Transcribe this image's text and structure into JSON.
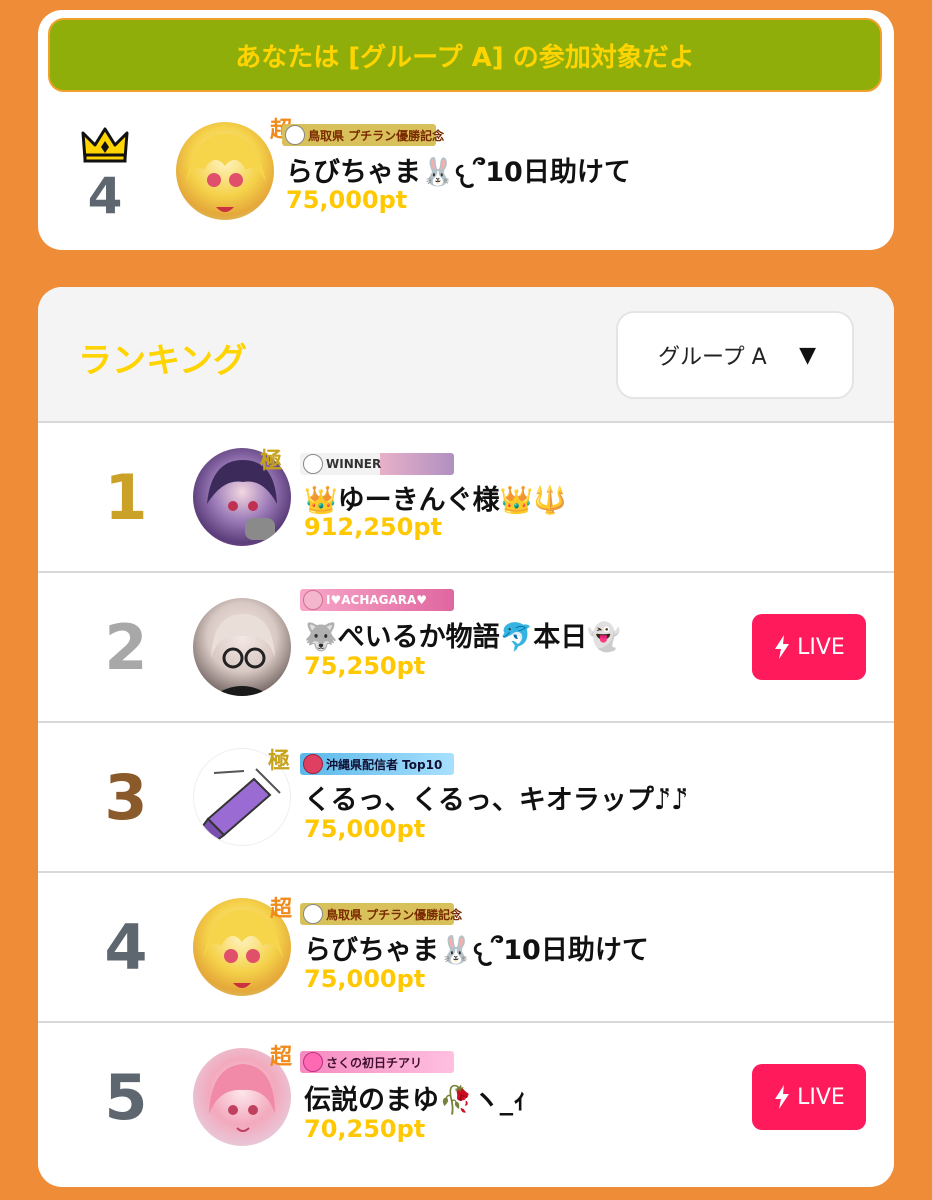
{
  "banner": "あなたは [グループ A] の参加対象だよ",
  "my_entry": {
    "rank": "4",
    "rank_icon": "crown-icon",
    "tier": "超",
    "badge": "鳥取県 プチラン優勝記念",
    "name": "らびちゃま🐰𐔌՞10日助けて",
    "points": "75,000pt"
  },
  "ranking": {
    "title": "ランキング",
    "group_select": {
      "value": "グループ A",
      "icon": "triangle-down-icon"
    },
    "rows": [
      {
        "rank": "1",
        "rank_color": "#c9a227",
        "tier": "極",
        "badge": "WINNER",
        "name": "👑ゆーきんぐ様👑🔱",
        "points": "912,250pt",
        "live": ""
      },
      {
        "rank": "2",
        "rank_color": "#a8a8a8",
        "tier": "",
        "badge": "I♥ACHAGARA♥",
        "name": "🐺ぺいるか物語🐬本日👻",
        "points": "75,250pt",
        "live": "LIVE"
      },
      {
        "rank": "3",
        "rank_color": "#8b5a2b",
        "tier": "極",
        "badge": "沖縄県配信者 Top10",
        "name": "くるっ、くるっ、キオラップ♪̈♪̈",
        "points": "75,000pt",
        "live": ""
      },
      {
        "rank": "4",
        "rank_color": "#5e6770",
        "tier": "超",
        "badge": "鳥取県 プチラン優勝記念",
        "name": "らびちゃま🐰𐔌՞10日助けて",
        "points": "75,000pt",
        "live": ""
      },
      {
        "rank": "5",
        "rank_color": "#5e6770",
        "tier": "超",
        "badge": "さくの初日チアリ",
        "name": "伝説のまゆ🥀ヽ_ｨ",
        "points": "70,250pt",
        "live": "LIVE"
      }
    ]
  },
  "colors": {
    "background": "#ee8c38",
    "banner": "#8fae0a",
    "accent_yellow": "#ffd400",
    "points": "#ffc800",
    "live": "#ff1a5c"
  }
}
